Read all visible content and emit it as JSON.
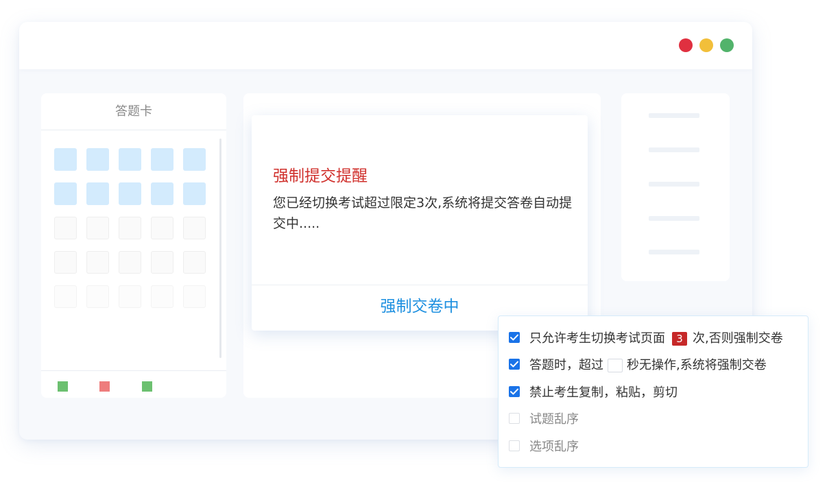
{
  "window": {
    "controls": {
      "close_color": "#e03040",
      "minimize_color": "#f2bf3a",
      "maximize_color": "#52b36b"
    }
  },
  "answer_card": {
    "title": "答题卡",
    "grid": {
      "columns": 5,
      "rows": [
        [
          "done",
          "done",
          "done",
          "done",
          "done"
        ],
        [
          "done",
          "done",
          "done",
          "done",
          "done"
        ],
        [
          "empty",
          "empty",
          "empty",
          "empty",
          "empty"
        ],
        [
          "empty",
          "empty",
          "empty",
          "empty",
          "empty"
        ],
        [
          "faint",
          "faint",
          "faint",
          "faint",
          "faint"
        ]
      ]
    },
    "legend_colors": [
      "#6cc070",
      "#ee7d7d",
      "#6cc070"
    ]
  },
  "modal": {
    "title": "强制提交提醒",
    "message": "您已经切换考试超过限定3次,系统将提交答卷自动提交中.....",
    "action": "强制交卷中"
  },
  "settings": {
    "options": [
      {
        "checked": true,
        "prefix": "只允许考生切换考试页面",
        "value": "3",
        "suffix": "次,否则强制交卷"
      },
      {
        "checked": true,
        "prefix": "答题时，超过",
        "value": "",
        "suffix": "秒无操作,系统将强制交卷"
      },
      {
        "checked": true,
        "text": "禁止考生复制，粘贴，剪切"
      },
      {
        "checked": false,
        "text": "试题乱序"
      },
      {
        "checked": false,
        "text": "选项乱序"
      }
    ]
  },
  "colors": {
    "accent": "#1e90e0",
    "alert": "#d0312d",
    "checkbox": "#1a73e8"
  }
}
